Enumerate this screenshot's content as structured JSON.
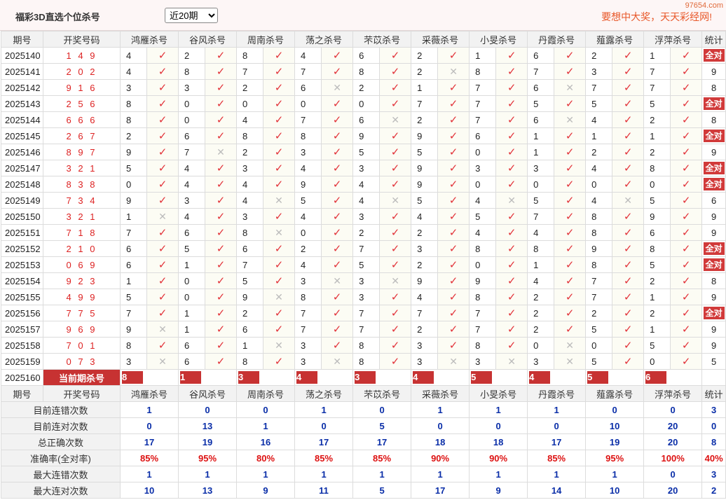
{
  "header": {
    "title": "福彩3D直选个位杀号",
    "period_selected": "近20期",
    "slogan": "要想中大奖，天天彩经网!",
    "watermark": "97654.com"
  },
  "table": {
    "col_issue": "期号",
    "col_draw": "开奖号码",
    "experts": [
      "鸿雁杀号",
      "谷风杀号",
      "周南杀号",
      "荡之杀号",
      "芣苡杀号",
      "采薇杀号",
      "小旻杀号",
      "丹霞杀号",
      "薤露杀号",
      "浮萍杀号"
    ],
    "col_stat": "统计",
    "all_correct_label": "全对",
    "rows": [
      {
        "issue": "2025140",
        "draw": "1 4 9",
        "kills": [
          "4",
          "2",
          "8",
          "4",
          "6",
          "2",
          "1",
          "6",
          "2",
          "1"
        ],
        "marks": [
          1,
          1,
          1,
          1,
          1,
          1,
          1,
          1,
          1,
          1
        ],
        "stat": "全对"
      },
      {
        "issue": "2025141",
        "draw": "2 0 2",
        "kills": [
          "4",
          "8",
          "7",
          "7",
          "8",
          "2",
          "8",
          "7",
          "3",
          "7"
        ],
        "marks": [
          1,
          1,
          1,
          1,
          1,
          0,
          1,
          1,
          1,
          1
        ],
        "stat": "9"
      },
      {
        "issue": "2025142",
        "draw": "9 1 6",
        "kills": [
          "3",
          "3",
          "2",
          "6",
          "2",
          "1",
          "7",
          "6",
          "7",
          "7"
        ],
        "marks": [
          1,
          1,
          1,
          0,
          1,
          1,
          1,
          0,
          1,
          1
        ],
        "stat": "8"
      },
      {
        "issue": "2025143",
        "draw": "2 5 6",
        "kills": [
          "8",
          "0",
          "0",
          "0",
          "0",
          "7",
          "7",
          "5",
          "5",
          "5"
        ],
        "marks": [
          1,
          1,
          1,
          1,
          1,
          1,
          1,
          1,
          1,
          1
        ],
        "stat": "全对"
      },
      {
        "issue": "2025144",
        "draw": "6 6 6",
        "kills": [
          "8",
          "0",
          "4",
          "7",
          "6",
          "2",
          "7",
          "6",
          "4",
          "2"
        ],
        "marks": [
          1,
          1,
          1,
          1,
          0,
          1,
          1,
          0,
          1,
          1
        ],
        "stat": "8"
      },
      {
        "issue": "2025145",
        "draw": "2 6 7",
        "kills": [
          "2",
          "6",
          "8",
          "8",
          "9",
          "9",
          "6",
          "1",
          "1",
          "1"
        ],
        "marks": [
          1,
          1,
          1,
          1,
          1,
          1,
          1,
          1,
          1,
          1
        ],
        "stat": "全对"
      },
      {
        "issue": "2025146",
        "draw": "8 9 7",
        "kills": [
          "9",
          "7",
          "2",
          "3",
          "5",
          "5",
          "0",
          "1",
          "2",
          "2"
        ],
        "marks": [
          1,
          0,
          1,
          1,
          1,
          1,
          1,
          1,
          1,
          1
        ],
        "stat": "9"
      },
      {
        "issue": "2025147",
        "draw": "3 2 1",
        "kills": [
          "5",
          "4",
          "3",
          "4",
          "3",
          "9",
          "3",
          "3",
          "4",
          "8"
        ],
        "marks": [
          1,
          1,
          1,
          1,
          1,
          1,
          1,
          1,
          1,
          1
        ],
        "stat": "全对"
      },
      {
        "issue": "2025148",
        "draw": "8 3 8",
        "kills": [
          "0",
          "4",
          "4",
          "9",
          "4",
          "9",
          "0",
          "0",
          "0",
          "0"
        ],
        "marks": [
          1,
          1,
          1,
          1,
          1,
          1,
          1,
          1,
          1,
          1
        ],
        "stat": "全对"
      },
      {
        "issue": "2025149",
        "draw": "7 3 4",
        "kills": [
          "9",
          "3",
          "4",
          "5",
          "4",
          "5",
          "4",
          "5",
          "4",
          "5"
        ],
        "marks": [
          1,
          1,
          0,
          1,
          0,
          1,
          0,
          1,
          0,
          1
        ],
        "stat": "6"
      },
      {
        "issue": "2025150",
        "draw": "3 2 1",
        "kills": [
          "1",
          "4",
          "3",
          "4",
          "3",
          "4",
          "5",
          "7",
          "8",
          "9"
        ],
        "marks": [
          0,
          1,
          1,
          1,
          1,
          1,
          1,
          1,
          1,
          1
        ],
        "stat": "9"
      },
      {
        "issue": "2025151",
        "draw": "7 1 8",
        "kills": [
          "7",
          "6",
          "8",
          "0",
          "2",
          "2",
          "4",
          "4",
          "8",
          "6"
        ],
        "marks": [
          1,
          1,
          0,
          1,
          1,
          1,
          1,
          1,
          1,
          1
        ],
        "stat": "9"
      },
      {
        "issue": "2025152",
        "draw": "2 1 0",
        "kills": [
          "6",
          "5",
          "6",
          "2",
          "7",
          "3",
          "8",
          "8",
          "9",
          "8"
        ],
        "marks": [
          1,
          1,
          1,
          1,
          1,
          1,
          1,
          1,
          1,
          1
        ],
        "stat": "全对"
      },
      {
        "issue": "2025153",
        "draw": "0 6 9",
        "kills": [
          "6",
          "1",
          "7",
          "4",
          "5",
          "2",
          "0",
          "1",
          "8",
          "5"
        ],
        "marks": [
          1,
          1,
          1,
          1,
          1,
          1,
          1,
          1,
          1,
          1
        ],
        "stat": "全对"
      },
      {
        "issue": "2025154",
        "draw": "9 2 3",
        "kills": [
          "1",
          "0",
          "5",
          "3",
          "3",
          "9",
          "9",
          "4",
          "7",
          "2"
        ],
        "marks": [
          1,
          1,
          1,
          0,
          0,
          1,
          1,
          1,
          1,
          1
        ],
        "stat": "8"
      },
      {
        "issue": "2025155",
        "draw": "4 9 9",
        "kills": [
          "5",
          "0",
          "9",
          "8",
          "3",
          "4",
          "8",
          "2",
          "7",
          "1"
        ],
        "marks": [
          1,
          1,
          0,
          1,
          1,
          1,
          1,
          1,
          1,
          1
        ],
        "stat": "9"
      },
      {
        "issue": "2025156",
        "draw": "7 7 5",
        "kills": [
          "7",
          "1",
          "2",
          "7",
          "7",
          "7",
          "7",
          "2",
          "2",
          "2"
        ],
        "marks": [
          1,
          1,
          1,
          1,
          1,
          1,
          1,
          1,
          1,
          1
        ],
        "stat": "全对"
      },
      {
        "issue": "2025157",
        "draw": "9 6 9",
        "kills": [
          "9",
          "1",
          "6",
          "7",
          "7",
          "2",
          "7",
          "2",
          "5",
          "1"
        ],
        "marks": [
          0,
          1,
          1,
          1,
          1,
          1,
          1,
          1,
          1,
          1
        ],
        "stat": "9"
      },
      {
        "issue": "2025158",
        "draw": "7 0 1",
        "kills": [
          "8",
          "6",
          "1",
          "3",
          "8",
          "3",
          "8",
          "0",
          "0",
          "5"
        ],
        "marks": [
          1,
          1,
          0,
          1,
          1,
          1,
          1,
          0,
          1,
          1
        ],
        "stat": "9"
      },
      {
        "issue": "2025159",
        "draw": "0 7 3",
        "kills": [
          "3",
          "6",
          "8",
          "3",
          "8",
          "3",
          "3",
          "3",
          "5",
          "0"
        ],
        "marks": [
          0,
          1,
          1,
          0,
          1,
          0,
          0,
          0,
          1,
          1
        ],
        "stat": "5"
      }
    ],
    "current": {
      "issue": "2025160",
      "label": "当前期杀号",
      "kills": [
        "8",
        "1",
        "3",
        "4",
        "3",
        "4",
        "5",
        "4",
        "5",
        "6"
      ]
    },
    "stats": [
      {
        "label": "目前连错次数",
        "values": [
          "1",
          "0",
          "0",
          "1",
          "0",
          "1",
          "1",
          "1",
          "0",
          "0"
        ],
        "total": "3",
        "color": "blue"
      },
      {
        "label": "目前连对次数",
        "values": [
          "0",
          "13",
          "1",
          "0",
          "5",
          "0",
          "0",
          "0",
          "10",
          "20"
        ],
        "total": "0",
        "color": "blue"
      },
      {
        "label": "总正确次数",
        "values": [
          "17",
          "19",
          "16",
          "17",
          "17",
          "18",
          "18",
          "17",
          "19",
          "20"
        ],
        "total": "8",
        "color": "blue"
      },
      {
        "label": "准确率(全对率)",
        "values": [
          "85%",
          "95%",
          "80%",
          "85%",
          "85%",
          "90%",
          "90%",
          "85%",
          "95%",
          "100%"
        ],
        "total": "40%",
        "color": "red"
      },
      {
        "label": "最大连错次数",
        "values": [
          "1",
          "1",
          "1",
          "1",
          "1",
          "1",
          "1",
          "1",
          "1",
          "0"
        ],
        "total": "3",
        "color": "blue"
      },
      {
        "label": "最大连对次数",
        "values": [
          "10",
          "13",
          "9",
          "11",
          "5",
          "17",
          "9",
          "14",
          "10",
          "20"
        ],
        "total": "2",
        "color": "blue"
      }
    ]
  },
  "colors": {
    "accent": "#c73232",
    "check": "#e2333a",
    "cross": "#bcbcbc",
    "blue": "#0a2ea8",
    "red": "#d11111"
  },
  "icons": {
    "check": "check-icon",
    "cross": "cross-icon"
  }
}
